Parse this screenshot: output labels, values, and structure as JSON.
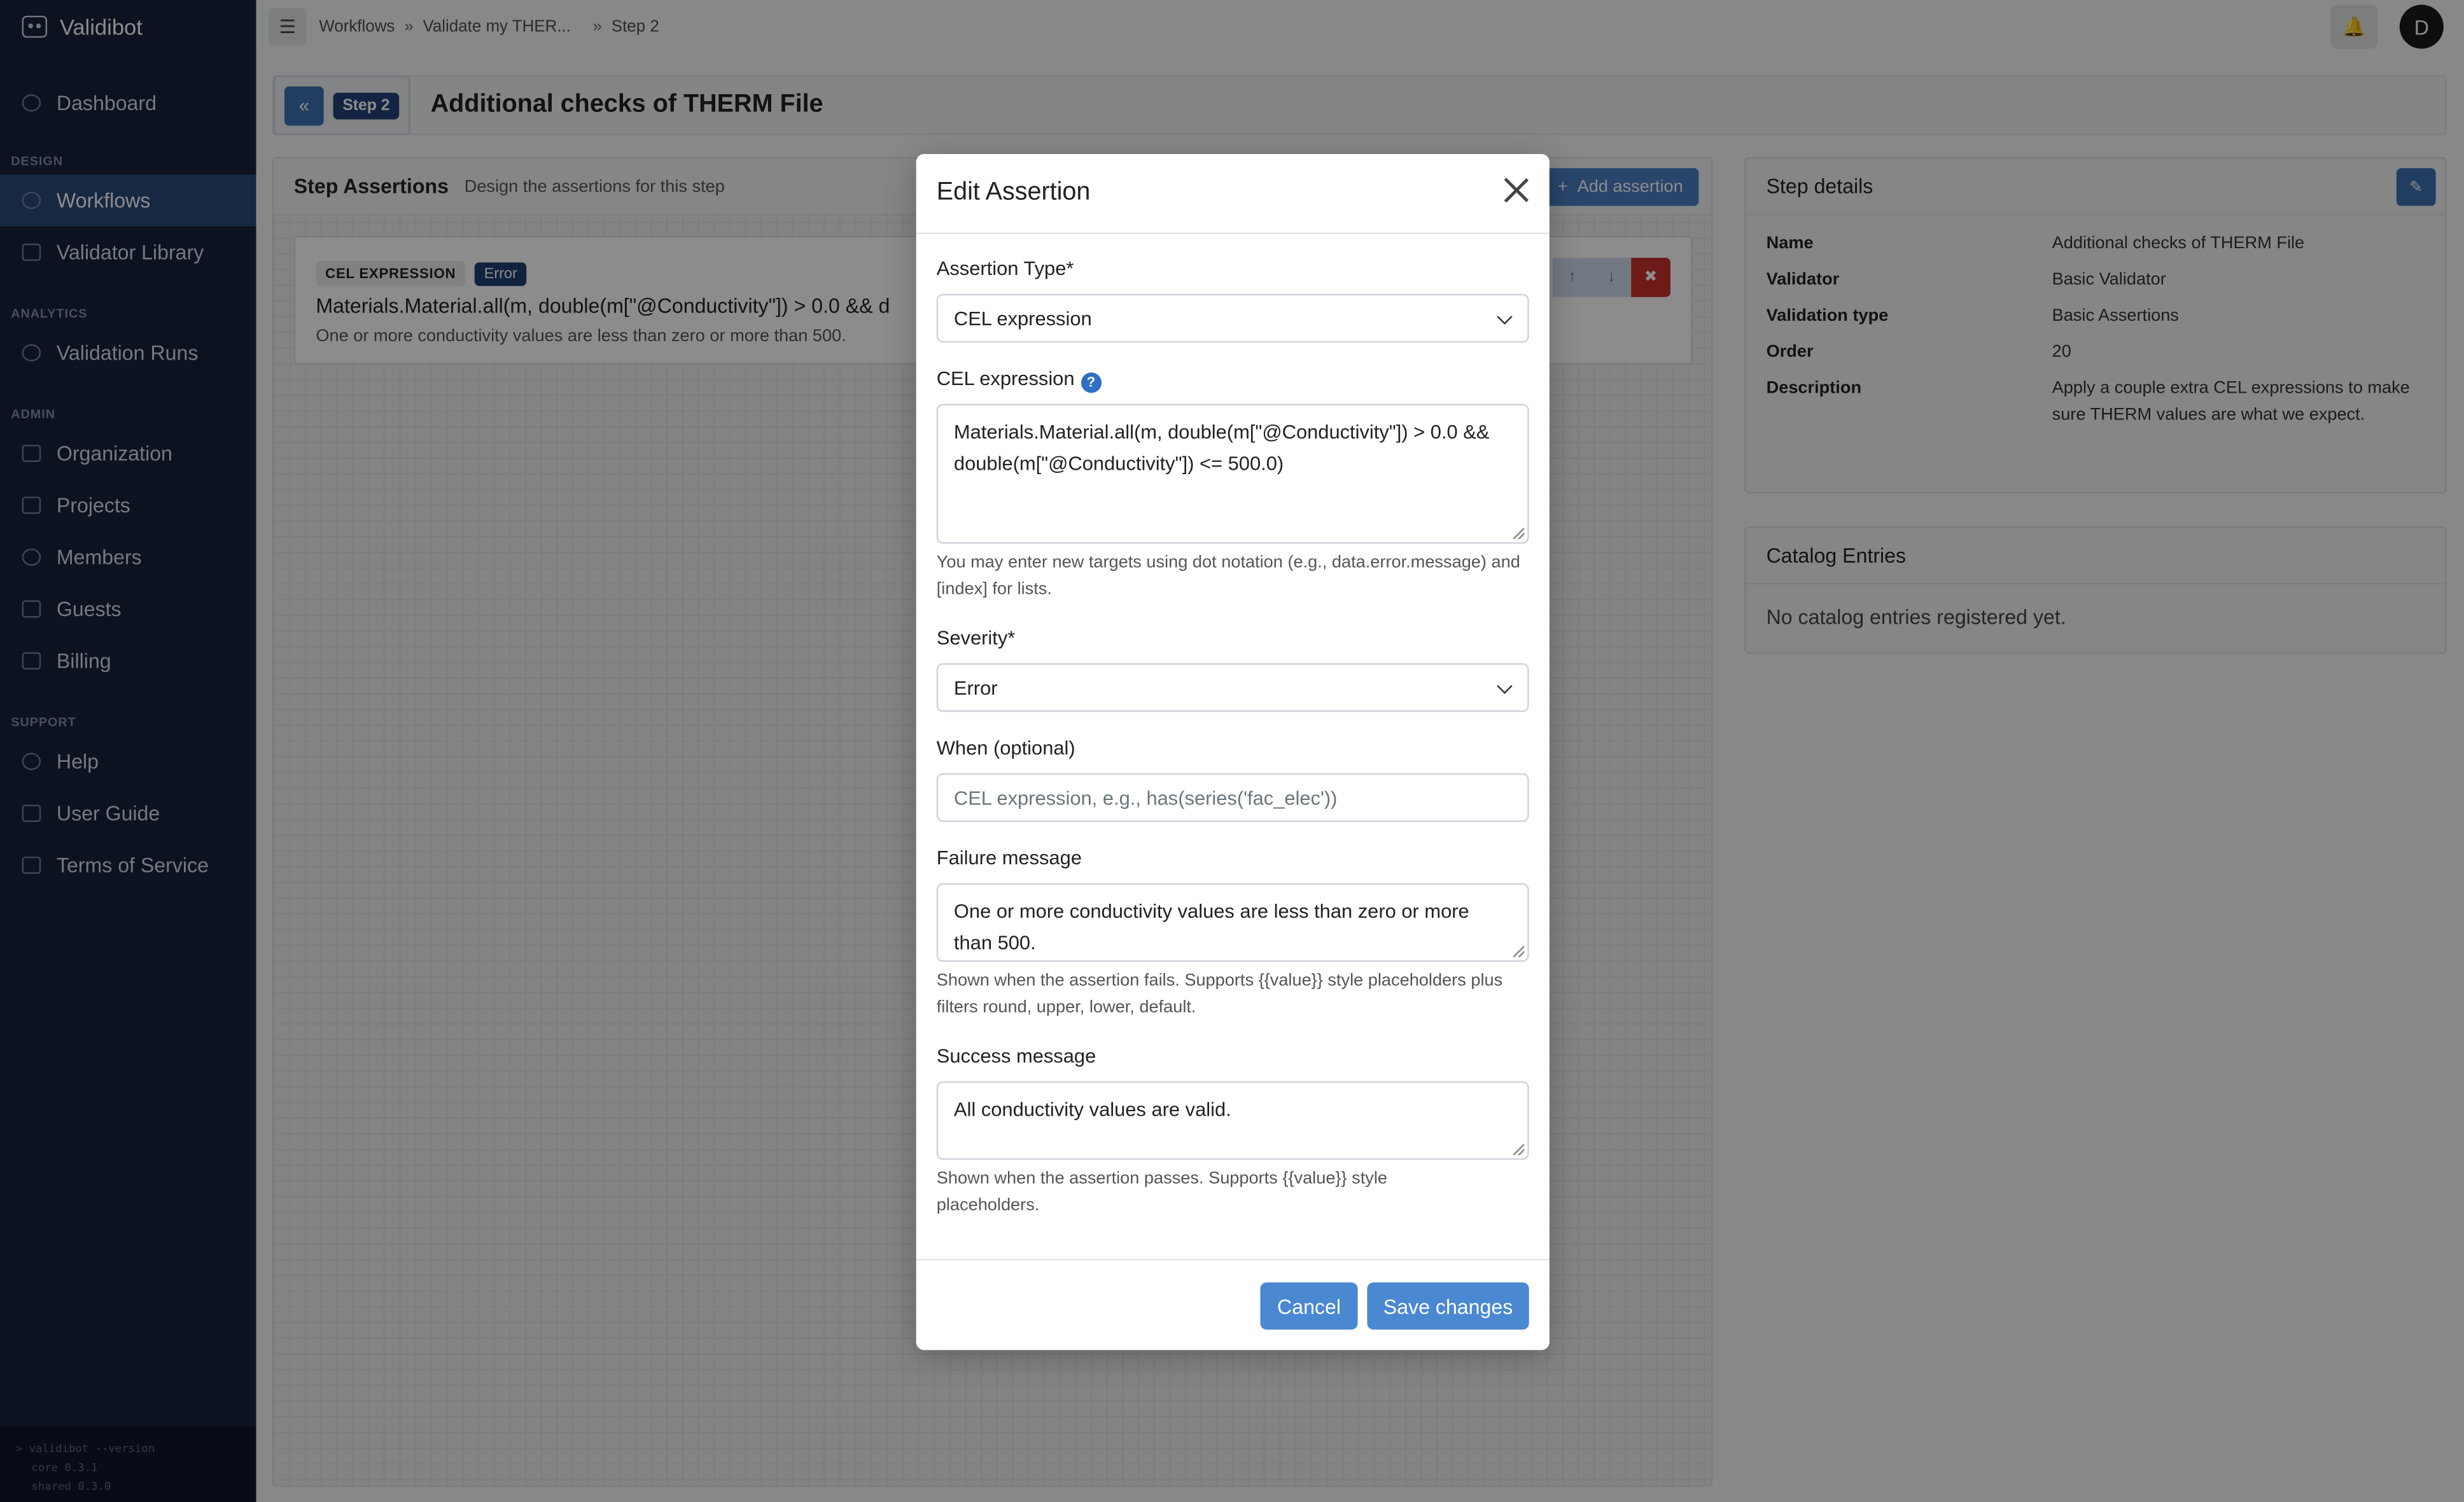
{
  "app": {
    "name": "Validibot"
  },
  "sidebar": {
    "top_item": "Dashboard",
    "sections": [
      {
        "label": "DESIGN",
        "items": [
          "Workflows",
          "Validator Library"
        ]
      },
      {
        "label": "ANALYTICS",
        "items": [
          "Validation Runs"
        ]
      },
      {
        "label": "ADMIN",
        "items": [
          "Organization",
          "Projects",
          "Members",
          "Guests",
          "Billing"
        ]
      },
      {
        "label": "SUPPORT",
        "items": [
          "Help",
          "User Guide",
          "Terms of Service"
        ]
      }
    ],
    "active_item": "Workflows",
    "terminal": [
      "> validibot --version",
      "core 0.3.1",
      "shared 0.3.0"
    ]
  },
  "topbar": {
    "breadcrumb": [
      "Workflows",
      "Validate my THER...",
      "Step 2"
    ],
    "breadcrumb_sep": "»",
    "avatar_initial": "D"
  },
  "header": {
    "step_badge": "Step 2",
    "title": "Additional checks of THERM File"
  },
  "assertions": {
    "title": "Step Assertions",
    "subtitle": "Design the assertions for this step",
    "add_label": "Add assertion",
    "card": {
      "type_tag": "CEL EXPRESSION",
      "severity_tag": "Error",
      "expression": "Materials.Material.all(m, double(m[\"@Conductivity\"]) > 0.0 && d",
      "message": "One or more conductivity values are less than zero or more than 500."
    }
  },
  "step_details": {
    "title": "Step details",
    "rows": [
      {
        "key": "Name",
        "value": "Additional checks of THERM File"
      },
      {
        "key": "Validator",
        "value": "Basic Validator"
      },
      {
        "key": "Validation type",
        "value": "Basic Assertions"
      },
      {
        "key": "Order",
        "value": "20"
      },
      {
        "key": "Description",
        "value": "Apply a couple extra CEL expressions to make sure THERM values are what we expect."
      }
    ]
  },
  "catalog": {
    "title": "Catalog Entries",
    "empty": "No catalog entries registered yet."
  },
  "modal": {
    "title": "Edit Assertion",
    "assertion_type_label": "Assertion Type*",
    "assertion_type_value": "CEL expression",
    "cel_label": "CEL expression",
    "cel_value": "Materials.Material.all(m, double(m[\"@Conductivity\"]) > 0.0 && double(m[\"@Conductivity\"]) <= 500.0)",
    "cel_help": "You may enter new targets using dot notation (e.g., data.error.message) and [index] for lists.",
    "severity_label": "Severity*",
    "severity_value": "Error",
    "when_label": "When (optional)",
    "when_placeholder": "CEL expression, e.g., has(series('fac_elec'))",
    "failure_label": "Failure message",
    "failure_value": "One or more conductivity values are less than zero or more than 500.",
    "failure_help": "Shown when the assertion fails. Supports {{value}} style placeholders plus filters round, upper, lower, default.",
    "success_label": "Success message",
    "success_value": "All conductivity values are valid.",
    "success_help": "Shown when the assertion passes. Supports {{value}} style placeholders.",
    "cancel_label": "Cancel",
    "save_label": "Save changes"
  }
}
